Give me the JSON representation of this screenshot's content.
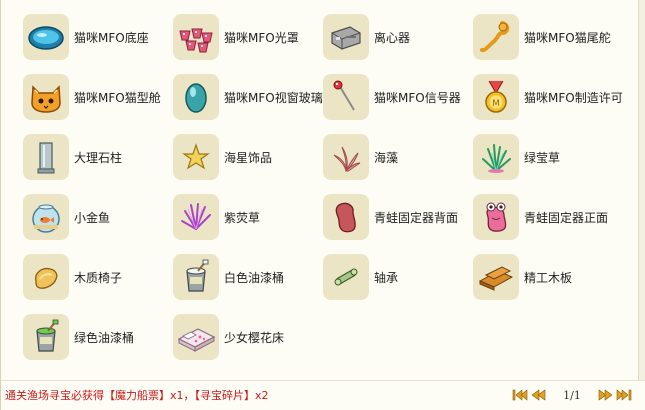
{
  "items": [
    {
      "label": "猫咪MFO底座",
      "icon": "blue-oval-base-icon"
    },
    {
      "label": "猫咪MFO光罩",
      "icon": "pink-cups-icon"
    },
    {
      "label": "离心器",
      "icon": "grey-machine-icon"
    },
    {
      "label": "猫咪MFO猫尾舵",
      "icon": "orange-tail-icon"
    },
    {
      "label": "猫咪MFO猫型舱",
      "icon": "orange-cat-face-icon"
    },
    {
      "label": "猫咪MFO视窗玻璃",
      "icon": "teal-egg-glass-icon"
    },
    {
      "label": "猫咪MFO信号器",
      "icon": "red-antenna-icon"
    },
    {
      "label": "猫咪MFO制造许可",
      "icon": "gold-medal-icon"
    },
    {
      "label": "大理石柱",
      "icon": "marble-pillar-icon"
    },
    {
      "label": "海星饰品",
      "icon": "starfish-icon"
    },
    {
      "label": "海藻",
      "icon": "seaweed-icon"
    },
    {
      "label": "绿莹草",
      "icon": "green-grass-icon"
    },
    {
      "label": "小金鱼",
      "icon": "goldfish-bowl-icon"
    },
    {
      "label": "紫荧草",
      "icon": "purple-grass-icon"
    },
    {
      "label": "青蛙固定器背面",
      "icon": "frog-holder-back-icon"
    },
    {
      "label": "青蛙固定器正面",
      "icon": "frog-holder-front-icon"
    },
    {
      "label": "木质椅子",
      "icon": "wooden-chair-icon"
    },
    {
      "label": "白色油漆桶",
      "icon": "white-paint-bucket-icon"
    },
    {
      "label": "轴承",
      "icon": "bearing-icon"
    },
    {
      "label": "精工木板",
      "icon": "wood-planks-icon"
    },
    {
      "label": "绿色油漆桶",
      "icon": "green-paint-bucket-icon"
    },
    {
      "label": "少女樱花床",
      "icon": "sakura-bed-icon"
    }
  ],
  "footer": {
    "reward_text": "通关渔场寻宝必获得【魔力船票】x1，【寻宝碎片】x2"
  },
  "pager": {
    "page_text": "1/1"
  },
  "colors": {
    "tile_bg": "#ebe5c5",
    "reward_text": "#cc1a1a",
    "pager_arrow": "#e0a020"
  }
}
